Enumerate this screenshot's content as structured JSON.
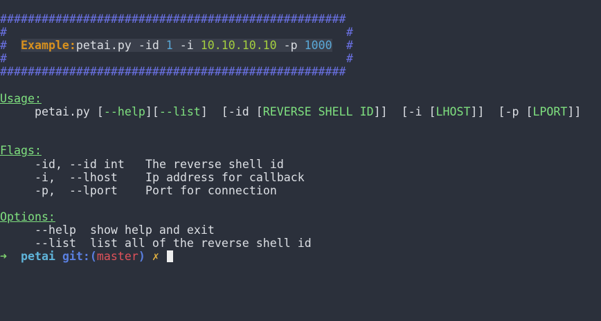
{
  "banner": {
    "hash_row": "##################################################",
    "side_left": "#",
    "side_right": "#",
    "example_label": "Example:",
    "cmd_prefix": "petai.py -id ",
    "id_value": "1",
    "ip_flag": " -i ",
    "ip_value": "10.10.10.10",
    "port_flag": " -p ",
    "port_value": "1000"
  },
  "usage": {
    "title": "Usage:",
    "script": "petai.py ",
    "b1": "[",
    "help": "--help",
    "b2": "][",
    "list": "--list",
    "b3": "]",
    "id_open": "  [-id ",
    "id_b1": "[",
    "id_arg": "REVERSE SHELL ID",
    "id_b2": "]]",
    "i_open": "  [-i ",
    "i_b1": "[",
    "i_arg": "LHOST",
    "i_b2": "]]",
    "p_open": "  [-p ",
    "p_b1": "[",
    "p_arg": "LPORT",
    "p_b2": "]]"
  },
  "flags": {
    "title": "Flags:",
    "rows": [
      {
        "flag": "-id, --id int",
        "desc": "The reverse shell id"
      },
      {
        "flag": "-i,  --lhost",
        "desc": "Ip address for callback"
      },
      {
        "flag": "-p,  --lport",
        "desc": "Port for connection"
      }
    ]
  },
  "options": {
    "title": "Options:",
    "rows": [
      {
        "opt": "--help",
        "desc": "show help and exit"
      },
      {
        "opt": "--list",
        "desc": "list all of the reverse shell id"
      }
    ]
  },
  "prompt": {
    "arrow": "➜",
    "dir": "petai",
    "git": "git:",
    "branch_open": "(",
    "branch": "master",
    "branch_close": ")",
    "dirty": "✗"
  },
  "colors": {
    "background": "#2b303b",
    "hash": "#6b72e6",
    "example_label": "#d9911e",
    "ip": "#a4cf3f",
    "number": "#5aa9d8",
    "section": "#7fe07f",
    "branch": "#e0525a"
  }
}
